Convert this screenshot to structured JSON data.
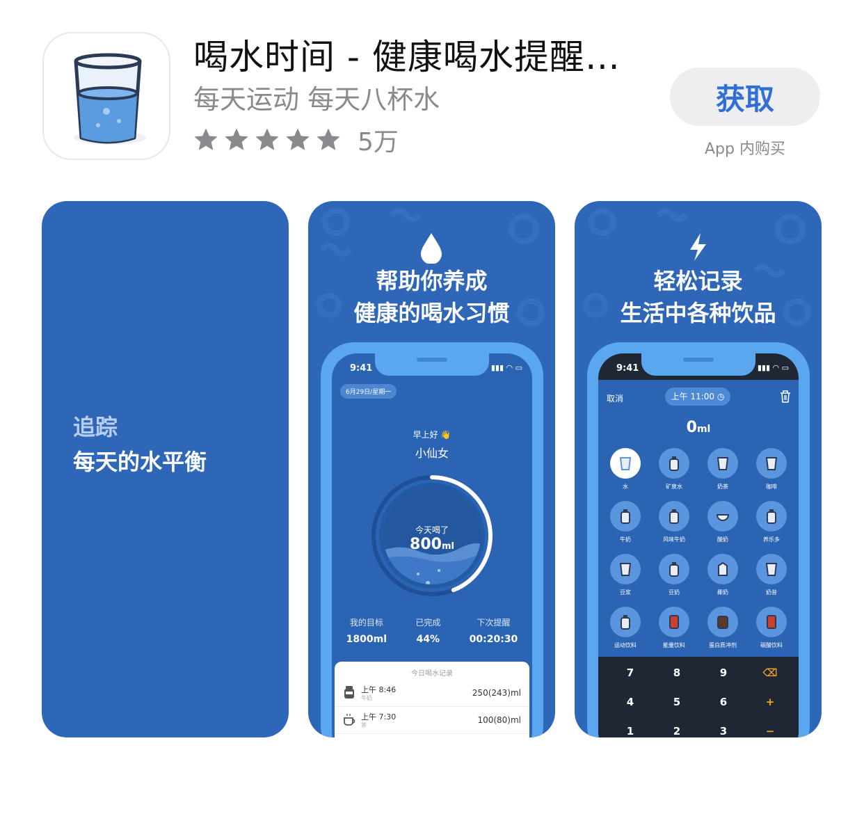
{
  "app": {
    "title": "喝水时间 - 健康喝水提醒…",
    "subtitle": "每天运动 每天八杯水",
    "rating_count": "5万",
    "rating_stars": 5,
    "get_label": "获取",
    "iap_note": "App 内购买",
    "accent_color": "#2f6fd6",
    "icon": "water-glass-icon"
  },
  "screenshots": {
    "first": {
      "line1": "追踪",
      "line2": "每天的水平衡"
    },
    "second": {
      "title_line1": "帮助你养成",
      "title_line2": "健康的喝水习惯",
      "icon": "water-drop-icon",
      "phone": {
        "time": "9:41",
        "date_chip": "6月29日/星期一",
        "greeting": "早上好 👋",
        "user_name": "小仙女",
        "today_label": "今天喝了",
        "today_amount": "800",
        "today_unit": "ml",
        "progress": 0.44,
        "stats": [
          {
            "label": "我的目标",
            "value": "1800ml"
          },
          {
            "label": "已完成",
            "value": "44%"
          },
          {
            "label": "下次提醒",
            "value": "00:20:30"
          }
        ],
        "records_title": "今日喝水记录",
        "records": [
          {
            "time": "上午 8:46",
            "type": "牛奶",
            "amount": "250(243)ml",
            "icon": "milk-bottle-icon"
          },
          {
            "time": "上午 7:30",
            "type": "茶",
            "amount": "100(80)ml",
            "icon": "tea-cup-icon"
          }
        ]
      }
    },
    "third": {
      "title_line1": "轻松记录",
      "title_line2": "生活中各种饮品",
      "icon": "lightning-icon",
      "phone": {
        "time": "9:41",
        "cancel": "取消",
        "time_chip": "上午 11:00",
        "amount": "0",
        "unit": "ml",
        "drinks": [
          {
            "label": "水",
            "active": true
          },
          {
            "label": "矿泉水"
          },
          {
            "label": "奶茶"
          },
          {
            "label": "咖啡"
          },
          {
            "label": "牛奶"
          },
          {
            "label": "风味牛奶"
          },
          {
            "label": "酸奶"
          },
          {
            "label": "养乐多"
          },
          {
            "label": "豆浆"
          },
          {
            "label": "豆奶"
          },
          {
            "label": "椰奶"
          },
          {
            "label": "奶昔"
          },
          {
            "label": "运动饮料"
          },
          {
            "label": "能量饮料"
          },
          {
            "label": "蛋白质冲剂"
          },
          {
            "label": "碳酸饮料"
          }
        ],
        "keys": [
          [
            "7",
            "8",
            "9",
            "⌫"
          ],
          [
            "4",
            "5",
            "6",
            "+"
          ],
          [
            "1",
            "2",
            "3",
            "−"
          ]
        ]
      }
    }
  }
}
